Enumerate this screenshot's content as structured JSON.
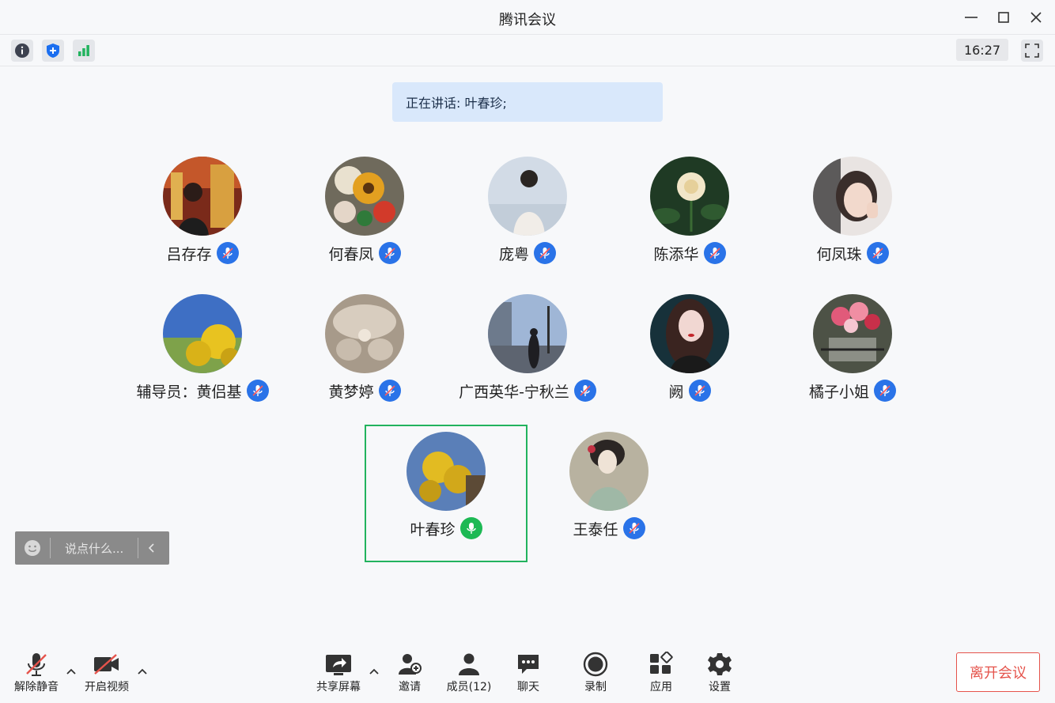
{
  "window": {
    "title": "腾讯会议"
  },
  "infobar": {
    "time": "16:27"
  },
  "speaking": {
    "text": "正在讲话: 叶春珍;"
  },
  "participants": [
    {
      "name": "吕存存",
      "mic": "muted"
    },
    {
      "name": "何春凤",
      "mic": "muted"
    },
    {
      "name": "庞粤",
      "mic": "muted"
    },
    {
      "name": "陈添华",
      "mic": "muted"
    },
    {
      "name": "何凤珠",
      "mic": "muted"
    },
    {
      "name": "辅导员：黄侣基",
      "mic": "muted"
    },
    {
      "name": "黄梦婷",
      "mic": "muted"
    },
    {
      "name": "广西英华-宁秋兰",
      "mic": "muted"
    },
    {
      "name": "阙",
      "mic": "muted"
    },
    {
      "name": "橘子小姐",
      "mic": "muted"
    },
    {
      "name": "叶春珍",
      "mic": "active"
    },
    {
      "name": "王泰任",
      "mic": "muted"
    }
  ],
  "chat": {
    "placeholder": "说点什么..."
  },
  "toolbar": {
    "unmute": "解除静音",
    "video": "开启视频",
    "share": "共享屏幕",
    "invite": "邀请",
    "members": "成员(12)",
    "chat": "聊天",
    "record": "录制",
    "apps": "应用",
    "settings": "设置",
    "leave": "离开会议"
  },
  "colors": {
    "mic_muted": "#2a73e8",
    "mic_active": "#1db954",
    "active_border": "#22b35e",
    "leave": "#e5534b",
    "banner": "#d9e8fb"
  }
}
